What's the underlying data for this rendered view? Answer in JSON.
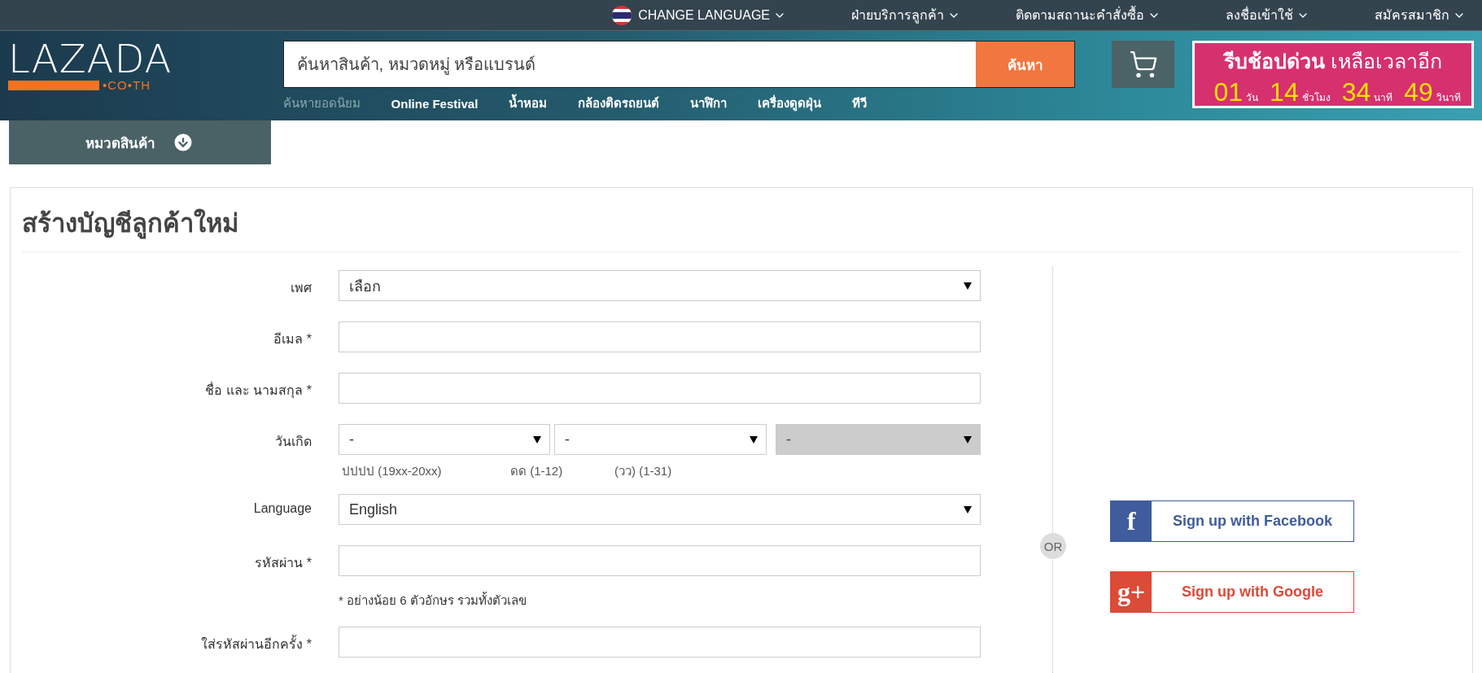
{
  "top_bar": {
    "language": "CHANGE LANGUAGE",
    "links": [
      "ฝ่ายบริการลูกค้า",
      "ติดตามสถานะคำสั่งซื้อ",
      "ลงชื่อเข้าใช้",
      "สมัครสมาชิก"
    ]
  },
  "logo": {
    "name": "LAZADA",
    "domain": "•CO•TH"
  },
  "search": {
    "placeholder": "ค้นหาสินค้า, หมวดหมู่ หรือแบรนด์",
    "button": "ค้นหา"
  },
  "popular": {
    "label": "ค้นหายอดนิยม",
    "links": [
      "Online Festival",
      "น้ำหอม",
      "กล้องติดรถยนต์",
      "นาฬิกา",
      "เครื่องดูดฝุ่น",
      "ทีวี"
    ]
  },
  "promo": {
    "title_bold": "รีบช้อปด่วน",
    "title": "เหลือเวลาอีก",
    "countdown": [
      {
        "value": "01",
        "unit": "วัน"
      },
      {
        "value": "14",
        "unit": "ชั่วโมง"
      },
      {
        "value": "34",
        "unit": "นาที"
      },
      {
        "value": "49",
        "unit": "วินาที"
      }
    ]
  },
  "category_button": "หมวดสินค้า",
  "form": {
    "title": "สร้างบัญชีลูกค้าใหม่",
    "rows": [
      {
        "kind": "select",
        "label": "เพศ",
        "value": "เลือก"
      },
      {
        "kind": "input",
        "label": "อีเมล *"
      },
      {
        "kind": "input",
        "label": "ชื่อ และ นามสกุล *"
      },
      {
        "kind": "date",
        "label": "วันเกิด",
        "selects": [
          {
            "value": "-",
            "hint": "ปปปป (19xx-20xx)",
            "disabled": false
          },
          {
            "value": "-",
            "hint": "ดด (1-12)",
            "disabled": false
          },
          {
            "value": "-",
            "hint": "(วว) (1-31)",
            "disabled": true
          }
        ]
      },
      {
        "kind": "select",
        "label": "Language",
        "value": "English"
      },
      {
        "kind": "input",
        "label": "รหัสผ่าน *",
        "note": "* อย่างน้อย 6 ตัวอักษร รวมทั้งตัวเลข"
      },
      {
        "kind": "input",
        "label": "ใส่รหัสผ่านอีกครั้ง *"
      }
    ]
  },
  "or": "OR",
  "social": [
    {
      "kind": "facebook",
      "icon": "f",
      "label": "Sign up with Facebook"
    },
    {
      "kind": "google",
      "icon": "g+",
      "label": "Sign up with Google"
    }
  ]
}
